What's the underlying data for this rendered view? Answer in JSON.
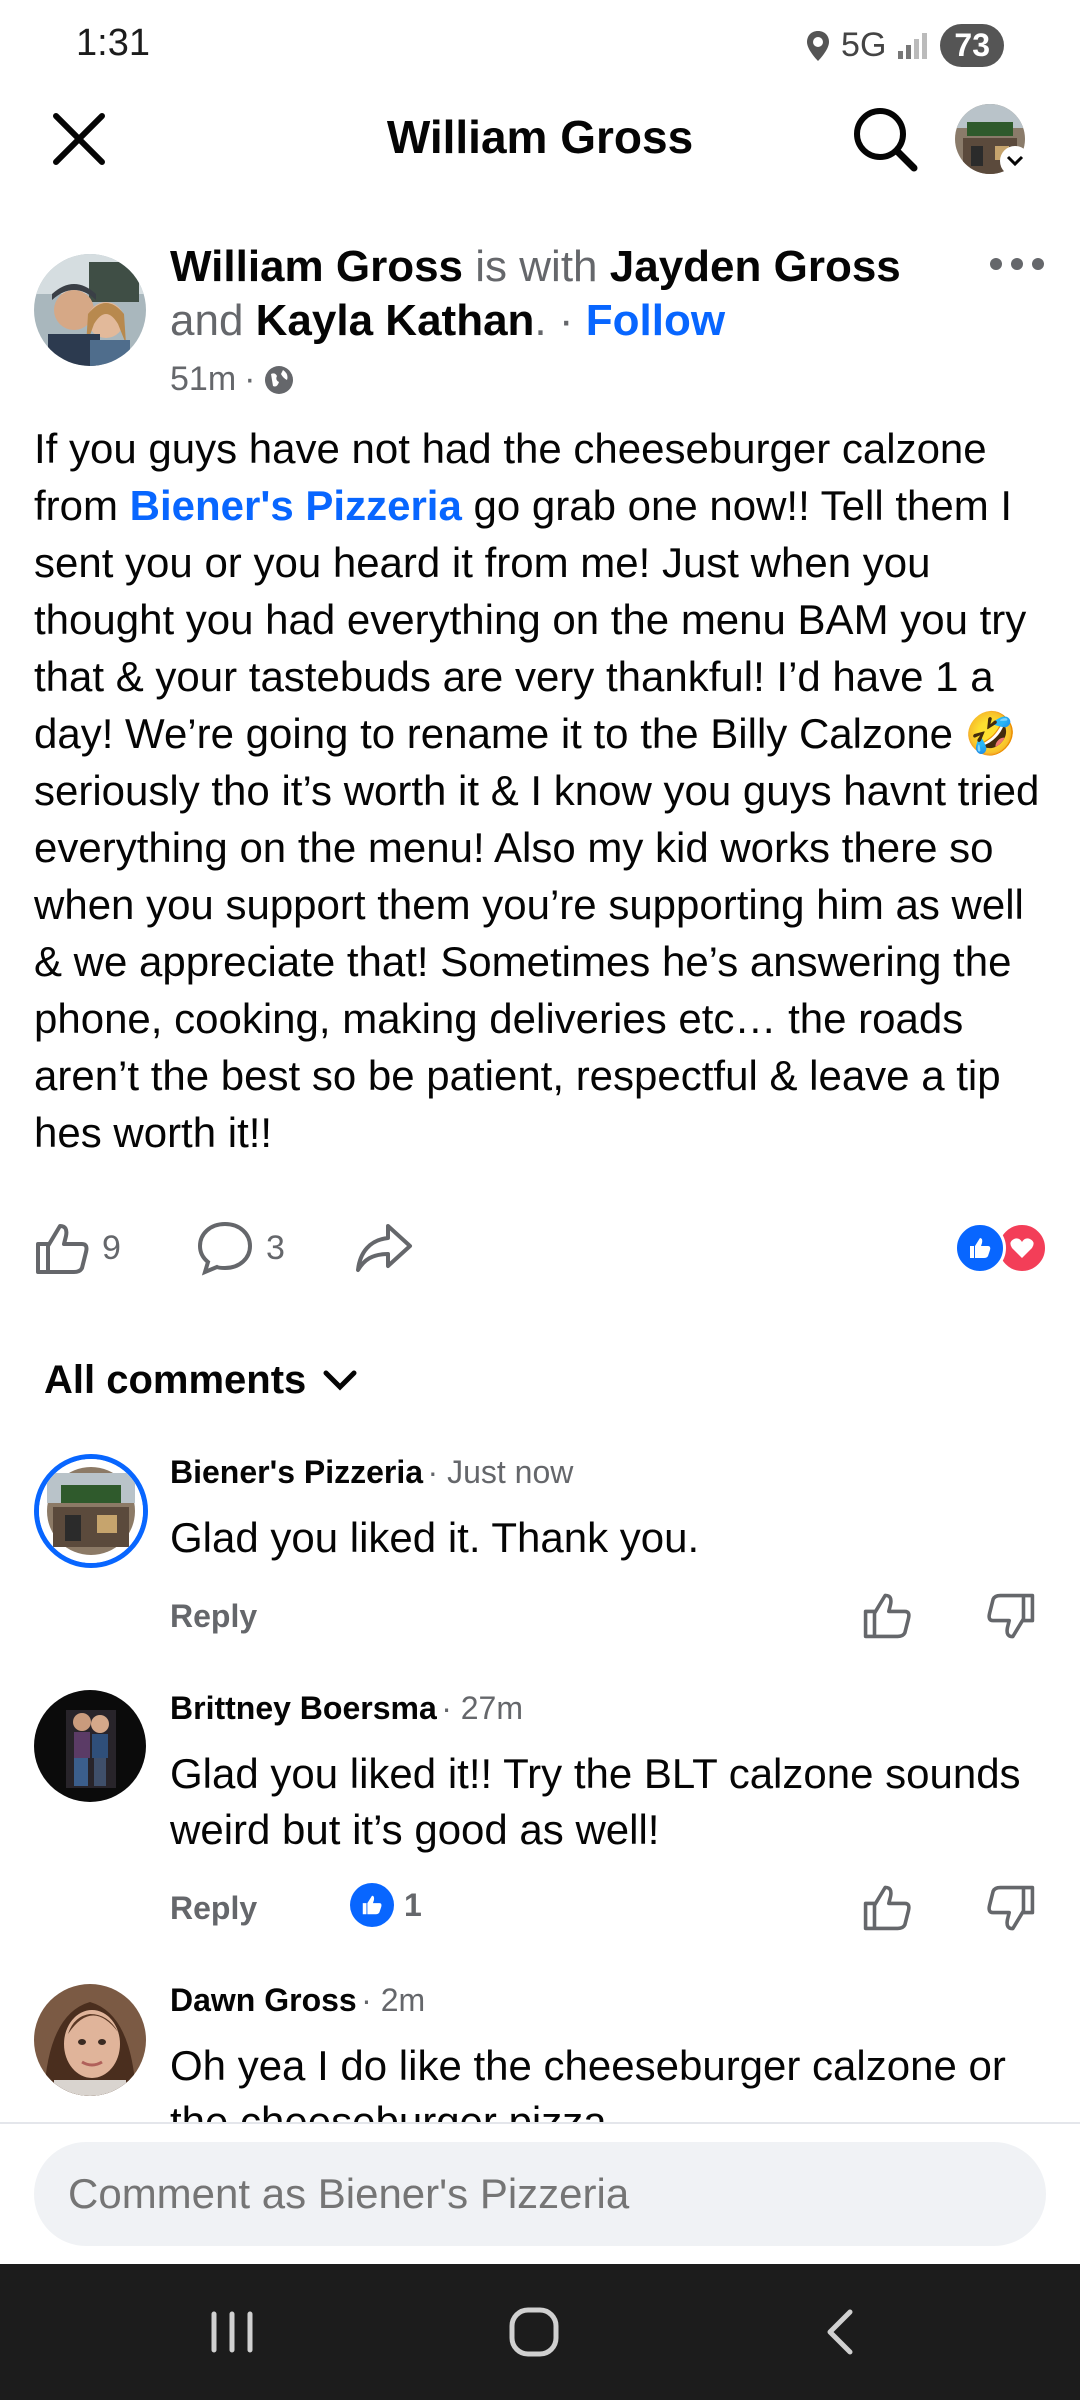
{
  "status": {
    "time": "1:31",
    "network": "5G",
    "battery": "73"
  },
  "header": {
    "title": "William Gross"
  },
  "post": {
    "author": "William Gross",
    "with_text": "is with",
    "tag1": "Jayden Gross",
    "and_text": "and",
    "tag2": "Kayla Kathan",
    "follow_label": "Follow",
    "time": "51m",
    "body_part1": "If you guys have not had the cheeseburger calzone from ",
    "body_link": "Biener's Pizzeria",
    "body_part2": " go grab one now!! Tell them I sent you or you heard it from me! Just when you thought you had everything on the menu BAM you try that & your tastebuds are very thankful! I’d have 1 a day! We’re going to rename it to the Billy Calzone ",
    "body_emoji": "🤣",
    "body_part3": " seriously tho it’s worth it & I know you guys havnt tried everything on the menu! Also my kid works there so when you support them you’re supporting him as well & we appreciate that! Sometimes he’s answering the phone, cooking, making deliveries etc… the roads aren’t the best so be patient, respectful & leave a tip hes worth it!!",
    "likes": "9",
    "comments": "3"
  },
  "comments_section": {
    "filter_label": "All comments",
    "items": [
      {
        "name": "Biener's Pizzeria",
        "time": "· Just now",
        "text": "Glad you liked it.  Thank you.",
        "reply": "Reply"
      },
      {
        "name": "Brittney Boersma",
        "time": "· 27m",
        "text": "Glad you liked it!! Try the BLT calzone sounds weird but it’s good as well!",
        "reply": "Reply",
        "reactions": "1"
      },
      {
        "name": "Dawn Gross",
        "time": "· 2m",
        "text": "Oh yea I do like the cheeseburger calzone or the cheeseburger pizza"
      }
    ]
  },
  "composer": {
    "placeholder": "Comment as Biener's Pizzeria"
  },
  "colors": {
    "accent": "#0866ff",
    "love": "#f33e58",
    "text": "#050505",
    "secondary": "#65676b"
  }
}
